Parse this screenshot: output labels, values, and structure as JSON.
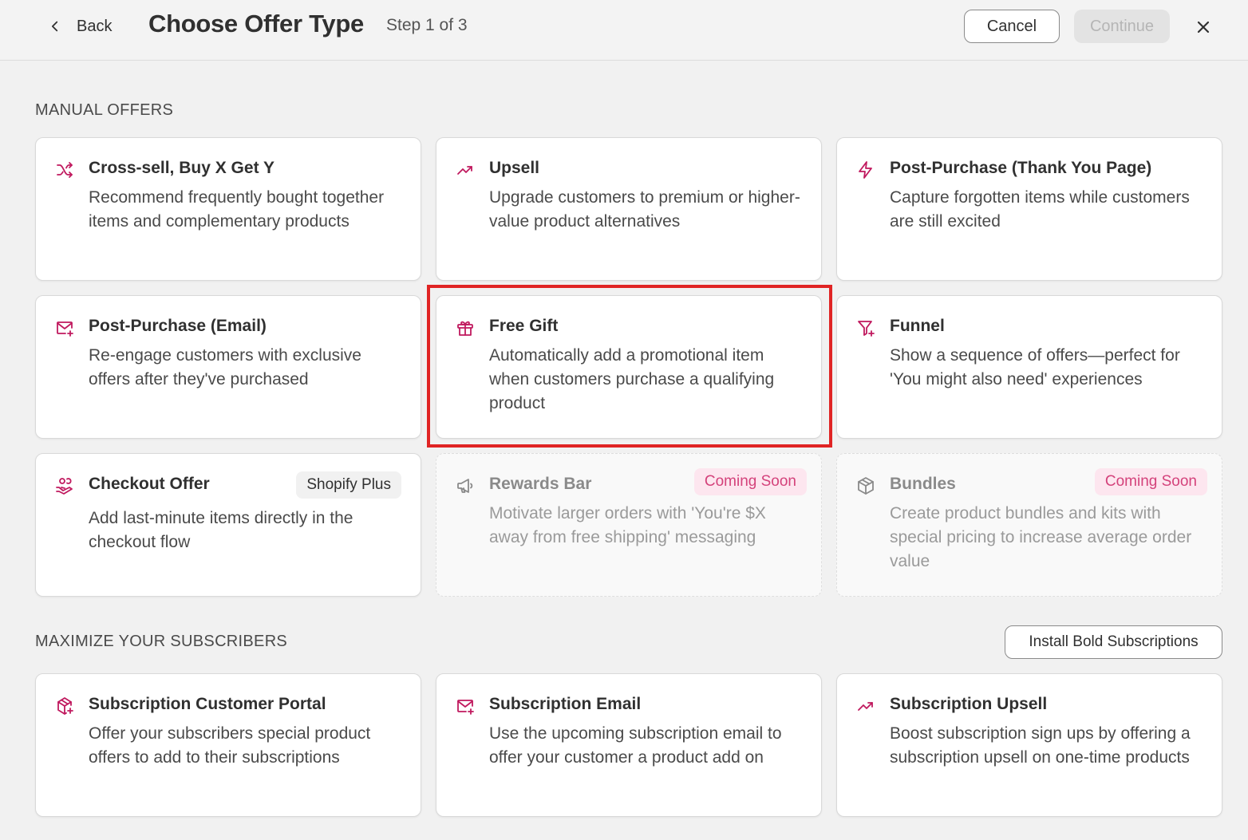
{
  "header": {
    "back_label": "Back",
    "title": "Choose Offer Type",
    "step": "Step 1 of 3",
    "cancel_label": "Cancel",
    "continue_label": "Continue"
  },
  "colors": {
    "accent": "#c0195e",
    "coming_soon_bg": "#fde6ef",
    "coming_soon_text": "#d4427b",
    "highlight": "#e02424"
  },
  "manual": {
    "label": "MANUAL OFFERS",
    "cards": [
      {
        "title": "Cross-sell, Buy X Get Y",
        "desc": "Recommend frequently bought together items and complementary products",
        "icon": "shuffle-icon"
      },
      {
        "title": "Upsell",
        "desc": "Upgrade customers to premium or higher-value product alternatives",
        "icon": "trending-up-icon"
      },
      {
        "title": "Post-Purchase (Thank You Page)",
        "desc": "Capture forgotten items while customers are still excited",
        "icon": "lightning-icon"
      },
      {
        "title": "Post-Purchase (Email)",
        "desc": "Re-engage customers with exclusive offers after they've purchased",
        "icon": "email-plus-icon"
      },
      {
        "title": "Free Gift",
        "desc": "Automatically add a promotional item when customers purchase a qualifying product",
        "icon": "gift-icon"
      },
      {
        "title": "Funnel",
        "desc": "Show a sequence of offers—perfect for 'You might also need' experiences",
        "icon": "funnel-plus-icon"
      },
      {
        "title": "Checkout Offer",
        "desc": "Add last-minute items directly in the checkout flow",
        "icon": "hand-coins-icon",
        "badge": "Shopify Plus"
      },
      {
        "title": "Rewards Bar",
        "desc": "Motivate larger orders with 'You're $X away from free shipping' messaging",
        "icon": "megaphone-icon",
        "badge": "Coming Soon"
      },
      {
        "title": "Bundles",
        "desc": "Create product bundles and kits with special pricing to increase average order value",
        "icon": "box-icon",
        "badge": "Coming Soon"
      }
    ]
  },
  "subscribers": {
    "label": "MAXIMIZE YOUR SUBSCRIBERS",
    "install_label": "Install Bold Subscriptions",
    "cards": [
      {
        "title": "Subscription Customer Portal",
        "desc": "Offer your subscribers special product offers to add to their subscriptions",
        "icon": "box-plus-icon"
      },
      {
        "title": "Subscription Email",
        "desc": "Use the upcoming subscription email to offer your customer a product add on",
        "icon": "email-plus-icon"
      },
      {
        "title": "Subscription Upsell",
        "desc": "Boost subscription sign ups by offering a subscription upsell on one-time products",
        "icon": "trending-up-icon"
      }
    ]
  }
}
